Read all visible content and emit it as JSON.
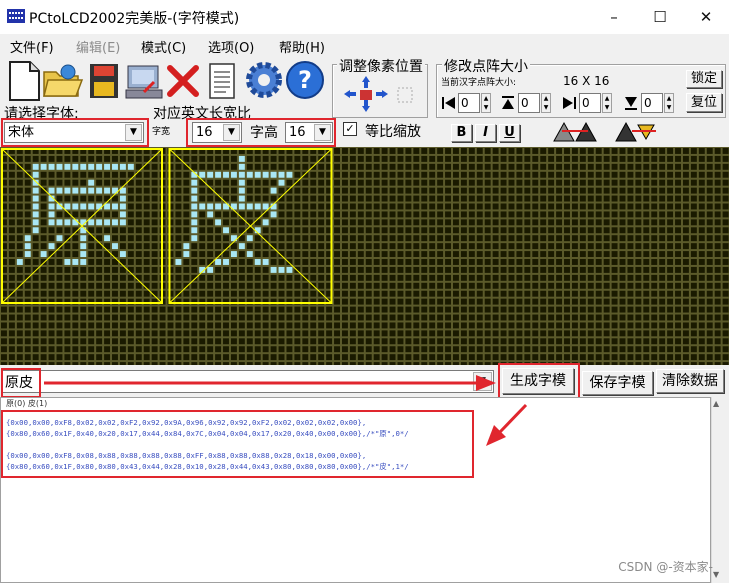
{
  "window": {
    "title": "PCtoLCD2002完美版-(字符模式)",
    "controls": [
      "–",
      "☐",
      "✕"
    ]
  },
  "menu": [
    {
      "label": "文件(F)",
      "enabled": true
    },
    {
      "label": "编辑(E)",
      "enabled": false
    },
    {
      "label": "模式(C)",
      "enabled": true
    },
    {
      "label": "选项(O)",
      "enabled": true
    },
    {
      "label": "帮助(H)",
      "enabled": true
    }
  ],
  "toolbar": {
    "icons": [
      "new-file-icon",
      "open-folder-icon",
      "save-disk-icon",
      "import-image-icon",
      "delete-x-icon",
      "notepad-icon",
      "settings-gear-icon",
      "help-icon"
    ],
    "pixel_group_title": "调整像素位置",
    "resize_group_title": "修改点阵大小",
    "current_size_label": "当前汉字点阵大小:",
    "current_size_value": "16 X 16",
    "lock_label": "锁定",
    "restore_label": "复位",
    "spinners": [
      "0",
      "0",
      "0",
      "0"
    ]
  },
  "font": {
    "select_label": "请选择字体:",
    "value": "宋体",
    "ratio_label": "对应英文长宽比",
    "width_label": "字宽",
    "width_value": "16",
    "height_label": "字高",
    "height_value": "16",
    "proportional_label": "等比缩放",
    "proportional_checked": true,
    "bold": "B",
    "italic": "I",
    "underline": "U"
  },
  "input": {
    "text": "原皮",
    "generate_label": "生成字模",
    "save_label": "保存字模",
    "clear_label": "清除数据"
  },
  "output": {
    "index_line": "原(0) 皮(1)",
    "lines": [
      "{0x00,0x00,0xF8,0x02,0x02,0xF2,0x92,0x9A,0x96,0x92,0x92,0xF2,0x02,0x02,0x02,0x00},",
      "{0x80,0x60,0x1F,0x40,0x20,0x17,0x44,0x84,0x7C,0x04,0x04,0x17,0x20,0x40,0x00,0x00},/*\"原\",0*/",
      "",
      "{0x00,0x00,0xF8,0x08,0x88,0x88,0x88,0x88,0xFF,0x88,0x88,0x88,0x28,0x18,0x00,0x00},",
      "{0x80,0x60,0x1F,0x80,0x80,0x43,0x44,0x28,0x10,0x28,0x44,0x43,0x80,0x80,0x80,0x00},/*\"皮\",1*/"
    ]
  },
  "matrix": {
    "cell_colors": {
      "off": "#1a1a00",
      "on": "#a9e7f5",
      "grid": "#5b5a2a",
      "outline": "#ffff00"
    },
    "chars": [
      {
        "char": "原",
        "rows": [
          "0000000000000000",
          "0011111111111110",
          "0010000000000000",
          "0010000001000000",
          "0010111111111100",
          "0010100000000100",
          "0010111111111100",
          "0010100000000100",
          "0010111111111100",
          "0010000010000000",
          "0100010010010000",
          "0100100010001000",
          "0101000010000100",
          "1000001110000000",
          "0000000000000000",
          "0000000000000000"
        ]
      },
      {
        "char": "皮",
        "rows": [
          "0000000010000000",
          "0000000010000000",
          "0011111111111110",
          "0010000010000100",
          "0010000010001000",
          "0010000010000000",
          "0011111111111000",
          "0010100000001000",
          "0010010000010000",
          "0010001000100000",
          "0010000101000000",
          "0100000010000000",
          "0100000101000000",
          "1000011000110000",
          "0001100000001110",
          "0000000000000000"
        ]
      }
    ]
  },
  "watermark": "CSDN @-资本家-"
}
